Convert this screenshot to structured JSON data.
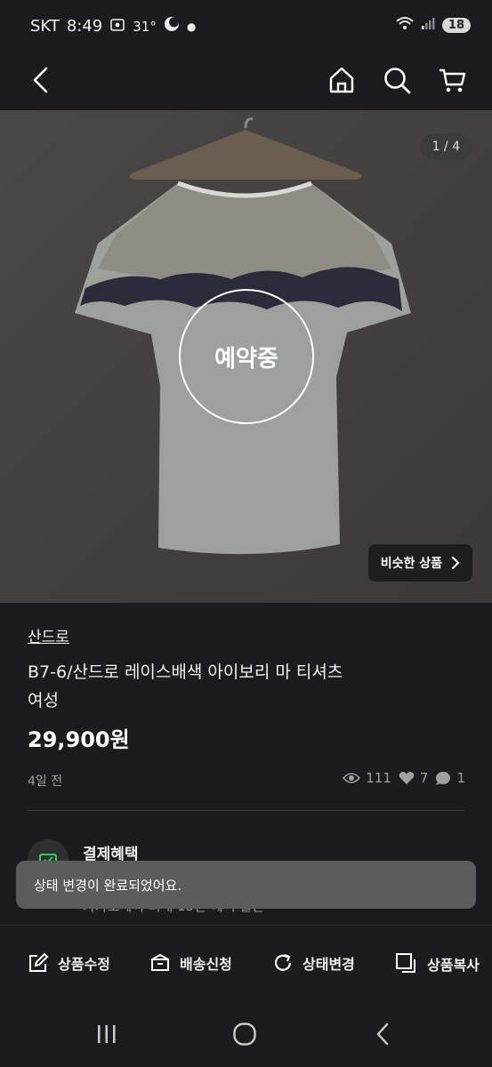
{
  "status_bar": {
    "carrier": "SKT",
    "time": "8:49",
    "temperature": "31°",
    "battery": "18"
  },
  "header": {
    "icons": [
      "back-icon",
      "home-icon",
      "search-icon",
      "cart-icon"
    ]
  },
  "hero": {
    "counter": "1 / 4",
    "status_overlay": "예약중",
    "similar_button": "비슷한 상품"
  },
  "product": {
    "brand": "산드로",
    "title_line1": "B7-6/산드로 레이스배색 아이보리 마 티셔츠",
    "title_line2": "여성",
    "price": "29,900원",
    "posted": "4일 전",
    "views": "111",
    "likes": "7",
    "chats": "1"
  },
  "benefit": {
    "title": "결제혜택",
    "subtitle": "카카오페이 최대 15만 혜택 월간"
  },
  "toast": {
    "message": "상태 변경이 완료되었어요."
  },
  "actions": {
    "edit": "상품수정",
    "shipping": "배송신청",
    "status": "상태변경",
    "copy": "상품복사"
  },
  "colors": {
    "background": "#1c1c1e",
    "toast": "#5c5c5c",
    "benefit_accent": "#2ecc71"
  }
}
